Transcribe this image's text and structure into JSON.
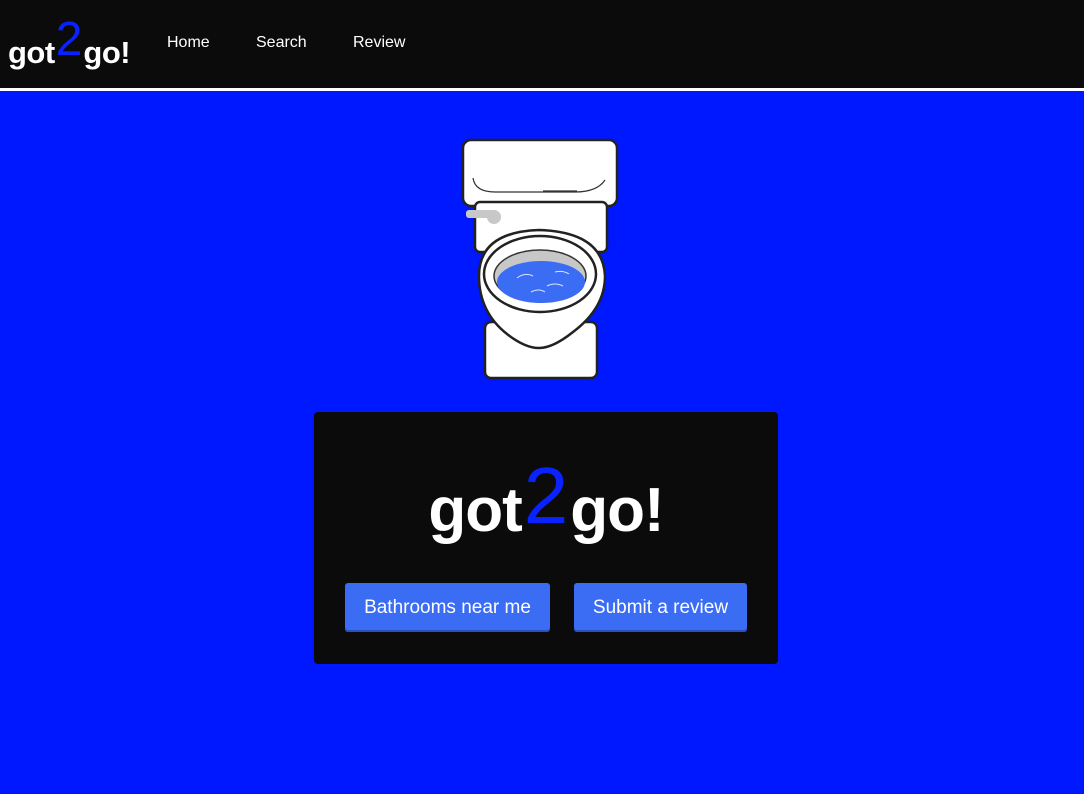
{
  "nav": {
    "brand": {
      "pre": "got",
      "mid": "2",
      "post": "go!"
    },
    "links": [
      {
        "label": "Home"
      },
      {
        "label": "Search"
      },
      {
        "label": "Review"
      }
    ]
  },
  "hero": {
    "image": "toilet-illustration",
    "title": {
      "pre": "got",
      "mid": "2",
      "post": "go!"
    },
    "buttons": [
      {
        "label": "Bathrooms near me"
      },
      {
        "label": "Submit a review"
      }
    ]
  },
  "colors": {
    "background": "#0018ff",
    "nav_background": "#0b0b0b",
    "accent": "#0a22ff",
    "button": "#3a6cf4"
  }
}
